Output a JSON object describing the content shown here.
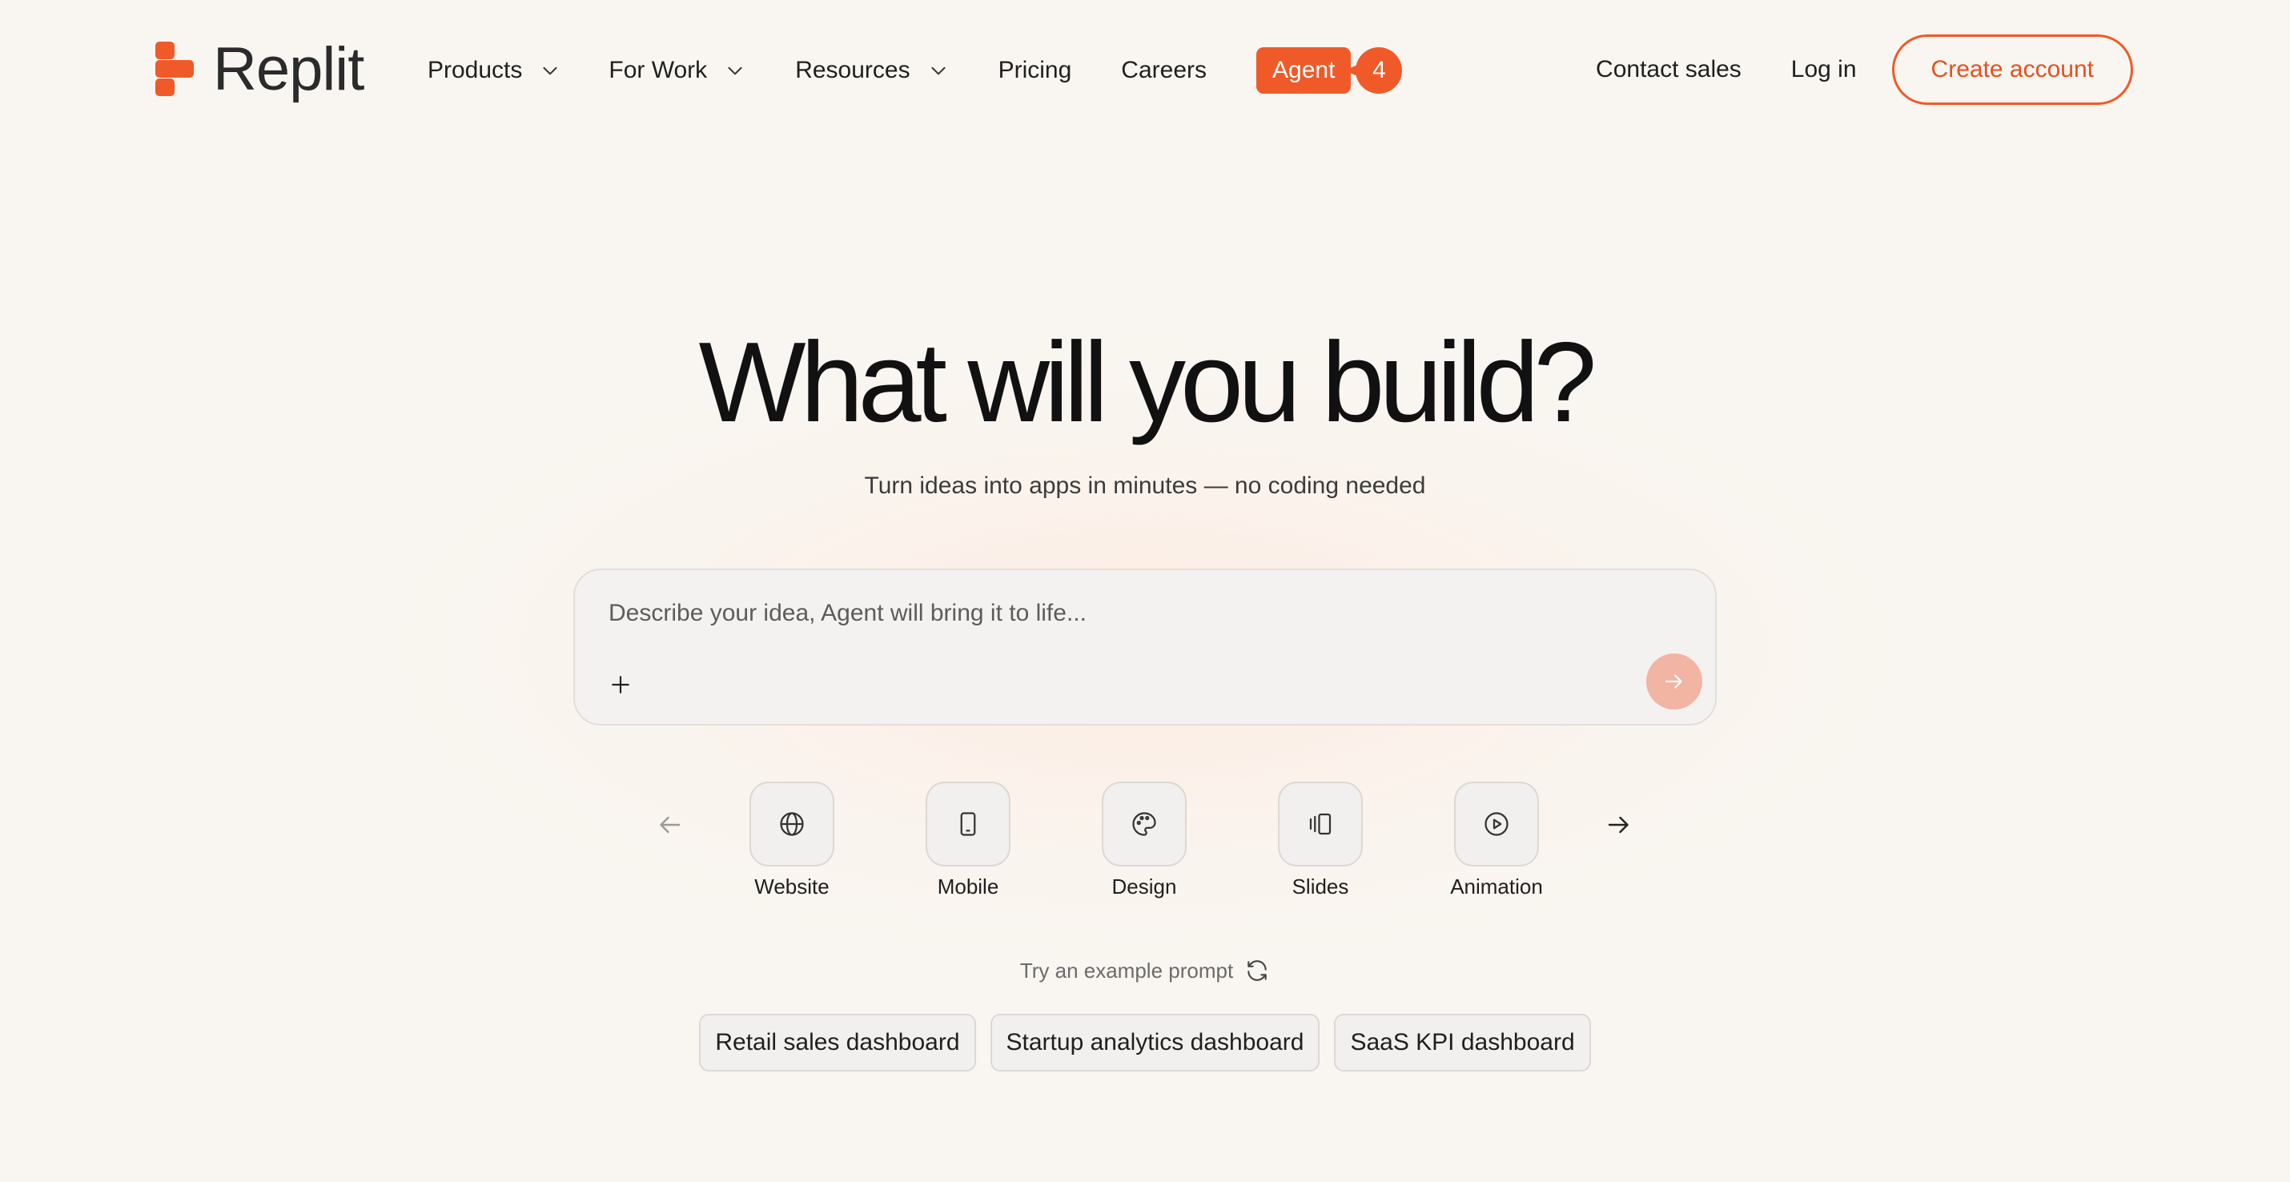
{
  "colors": {
    "accent": "#f05a28",
    "background": "#f9f6f1",
    "send_button_disabled": "#f2b4a3"
  },
  "header": {
    "logo_text": "Replit",
    "nav": {
      "products": "Products",
      "for_work": "For Work",
      "resources": "Resources",
      "pricing": "Pricing",
      "careers": "Careers",
      "agent": "Agent",
      "agent_badge": "4"
    },
    "contact_sales": "Contact sales",
    "log_in": "Log in",
    "create_account": "Create account"
  },
  "hero": {
    "title": "What will you build?",
    "subtitle": "Turn ideas into apps in minutes — no coding needed"
  },
  "prompt": {
    "placeholder": "Describe your idea, Agent will bring it to life...",
    "value": ""
  },
  "categories": [
    {
      "label": "Website",
      "icon": "globe-icon"
    },
    {
      "label": "Mobile",
      "icon": "phone-icon"
    },
    {
      "label": "Design",
      "icon": "palette-icon"
    },
    {
      "label": "Slides",
      "icon": "slides-icon"
    },
    {
      "label": "Animation",
      "icon": "play-icon"
    }
  ],
  "examples": {
    "try_label": "Try an example prompt",
    "prompts": [
      "Retail sales dashboard",
      "Startup analytics dashboard",
      "SaaS KPI dashboard"
    ]
  }
}
